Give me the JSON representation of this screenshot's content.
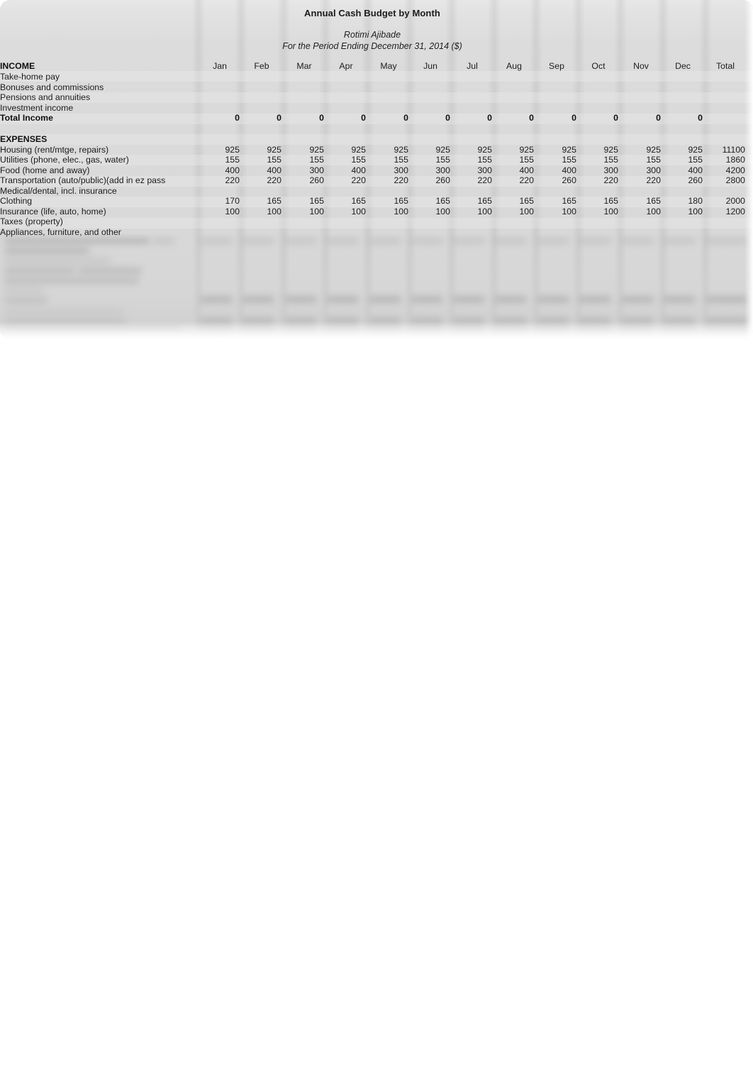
{
  "document": {
    "title": "Annual Cash Budget by Month",
    "author": "Rotimi Ajibade",
    "period": "For the Period Ending December 31, 2014 ($)"
  },
  "table": {
    "columns": [
      "Jan",
      "Feb",
      "Mar",
      "Apr",
      "May",
      "Jun",
      "Jul",
      "Aug",
      "Sep",
      "Oct",
      "Nov",
      "Dec",
      "Total"
    ],
    "sections": [
      {
        "heading": "INCOME",
        "rows": [
          {
            "label": "Take-home pay",
            "bold": false,
            "values": [
              "",
              "",
              "",
              "",
              "",
              "",
              "",
              "",
              "",
              "",
              "",
              "",
              ""
            ]
          },
          {
            "label": "Bonuses and commissions",
            "bold": false,
            "values": [
              "",
              "",
              "",
              "",
              "",
              "",
              "",
              "",
              "",
              "",
              "",
              "",
              ""
            ]
          },
          {
            "label": "Pensions and annuities",
            "bold": false,
            "values": [
              "",
              "",
              "",
              "",
              "",
              "",
              "",
              "",
              "",
              "",
              "",
              "",
              ""
            ]
          },
          {
            "label": "Investment income",
            "bold": false,
            "values": [
              "",
              "",
              "",
              "",
              "",
              "",
              "",
              "",
              "",
              "",
              "",
              "",
              ""
            ]
          },
          {
            "label": "Total Income",
            "bold": true,
            "values": [
              "0",
              "0",
              "0",
              "0",
              "0",
              "0",
              "0",
              "0",
              "0",
              "0",
              "0",
              "0",
              ""
            ]
          }
        ]
      },
      {
        "heading": "EXPENSES",
        "rows": [
          {
            "label": "Housing (rent/mtge, repairs)",
            "bold": false,
            "values": [
              "925",
              "925",
              "925",
              "925",
              "925",
              "925",
              "925",
              "925",
              "925",
              "925",
              "925",
              "925",
              "11100"
            ]
          },
          {
            "label": "Utilities (phone, elec., gas, water)",
            "bold": false,
            "values": [
              "155",
              "155",
              "155",
              "155",
              "155",
              "155",
              "155",
              "155",
              "155",
              "155",
              "155",
              "155",
              "1860"
            ]
          },
          {
            "label": "Food (home and away)",
            "bold": false,
            "values": [
              "400",
              "400",
              "300",
              "400",
              "300",
              "300",
              "300",
              "400",
              "400",
              "300",
              "300",
              "400",
              "4200"
            ]
          },
          {
            "label": "Transportation (auto/public)(add in ez pass",
            "bold": false,
            "values": [
              "220",
              "220",
              "260",
              "220",
              "220",
              "260",
              "220",
              "220",
              "260",
              "220",
              "220",
              "260",
              "2800"
            ]
          },
          {
            "label": "Medical/dental, incl. insurance",
            "bold": false,
            "values": [
              "",
              "",
              "",
              "",
              "",
              "",
              "",
              "",
              "",
              "",
              "",
              "",
              ""
            ]
          },
          {
            "label": "Clothing",
            "bold": false,
            "values": [
              "170",
              "165",
              "165",
              "165",
              "165",
              "165",
              "165",
              "165",
              "165",
              "165",
              "165",
              "180",
              "2000"
            ]
          },
          {
            "label": "Insurance (life, auto, home)",
            "bold": false,
            "values": [
              "100",
              "100",
              "100",
              "100",
              "100",
              "100",
              "100",
              "100",
              "100",
              "100",
              "100",
              "100",
              "1200"
            ]
          },
          {
            "label": "Taxes (property)",
            "bold": false,
            "values": [
              "",
              "",
              "",
              "",
              "",
              "",
              "",
              "",
              "",
              "",
              "",
              "",
              ""
            ]
          },
          {
            "label": "Appliances, furniture, and other",
            "bold": false,
            "values": [
              "",
              "",
              "",
              "",
              "",
              "",
              "",
              "",
              "",
              "",
              "",
              "",
              ""
            ]
          }
        ]
      }
    ],
    "obscured_note": "Remaining rows below are blurred and illegible in the source image"
  }
}
